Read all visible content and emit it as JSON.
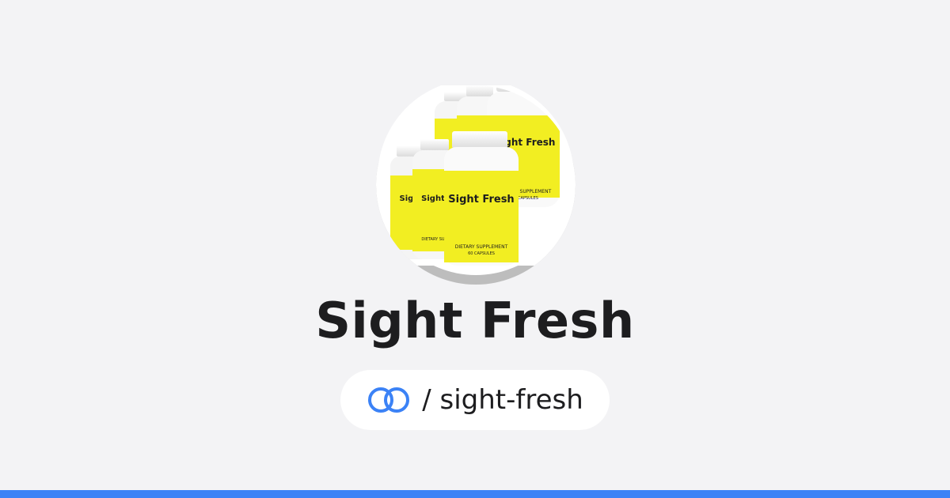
{
  "profile": {
    "title": "Sight Fresh",
    "avatar_icon": "product-bottles-image",
    "bottle_brand": "Sight Fresh",
    "bottle_type": "DIETARY SUPPLEMENT",
    "bottle_count": "60 CAPSULES"
  },
  "link": {
    "icon": "link-icon",
    "separator": "/",
    "slug": "sight-fresh",
    "display": "/ sight-fresh"
  },
  "colors": {
    "background": "#f3f3f5",
    "accent": "#3b82f6",
    "bottle_label": "#f2ee22",
    "text": "#1d1d1f"
  }
}
